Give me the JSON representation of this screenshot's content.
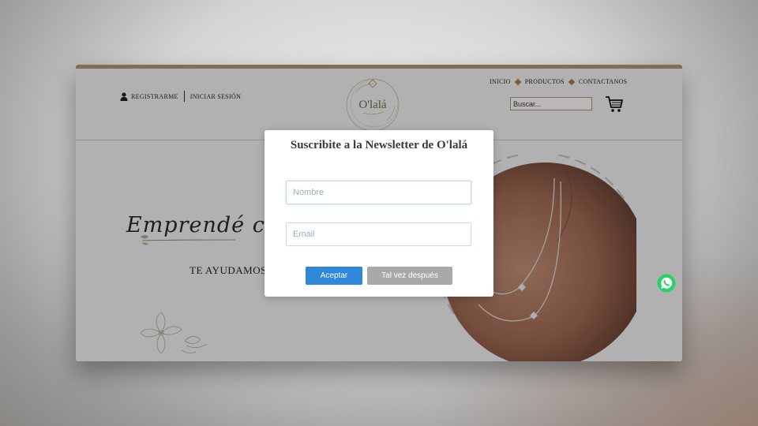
{
  "header": {
    "register_label": "REGISTRARME",
    "login_label": "INICIAR SESIÓN",
    "logo_text": "O'lalá",
    "nav": [
      "INICIO",
      "PRODUCTOS",
      "CONTACTANOS"
    ],
    "search_placeholder": "Buscar..."
  },
  "hero": {
    "script_text": "Emprendé co",
    "subtitle": "TE AYUDAMOS"
  },
  "modal": {
    "title": "Suscribite a la Newsletter de O'lalá",
    "name_placeholder": "Nombre",
    "email_placeholder": "Email",
    "accept_label": "Aceptar",
    "later_label": "Tal vez después"
  },
  "icons": {
    "user": "user-icon",
    "cart": "cart-icon",
    "whatsapp": "whatsapp-icon",
    "nav_separator": "diamond-icon"
  },
  "colors": {
    "accent_gold": "#b49a74",
    "nav_diamond": "#b07a4a",
    "accept_button": "#2f88d9",
    "later_button": "#a9a9a9",
    "whatsapp": "#25d366"
  }
}
